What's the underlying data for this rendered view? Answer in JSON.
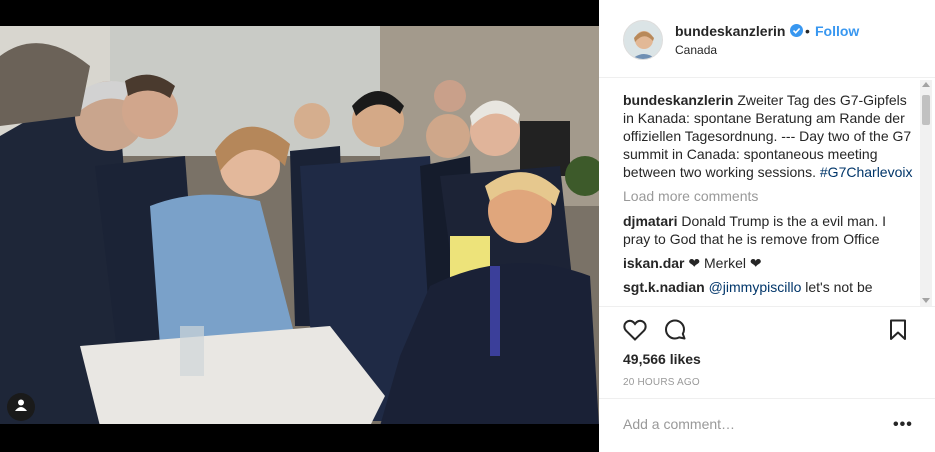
{
  "post": {
    "username": "bundeskanzlerin",
    "follow_label": "Follow",
    "separator": "•",
    "location": "Canada",
    "verified": true
  },
  "caption": {
    "username": "bundeskanzlerin",
    "text": "Zweiter Tag des G7-Gipfels in Kanada: spontane Beratung am Rande der offiziellen Tagesordnung. --- Day two of the G7 summit in Canada: spontaneous meeting between two working sessions.",
    "hashtag": "#G7Charlevoix"
  },
  "load_more_label": "Load more comments",
  "comments": [
    {
      "username": "djmatari",
      "text": "Donald Trump is the a evil man. I pray to God that he is remove from Office"
    },
    {
      "username": "iskan.dar",
      "text": "❤ Merkel ❤"
    },
    {
      "username": "sgt.k.nadian",
      "mention": "@jimmypiscillo",
      "text": "let's not be"
    }
  ],
  "likes": "49,566 likes",
  "time": "20 HOURS AGO",
  "comment_placeholder": "Add a comment…",
  "more_label": "•••",
  "colors": {
    "accent": "#3897f0",
    "link": "#003569",
    "muted": "#999999",
    "text": "#262626"
  },
  "icons": {
    "like": "heart-icon",
    "comment": "speech-bubble-icon",
    "save": "bookmark-icon",
    "tag": "user-tag-icon",
    "verified": "verified-badge-icon"
  }
}
